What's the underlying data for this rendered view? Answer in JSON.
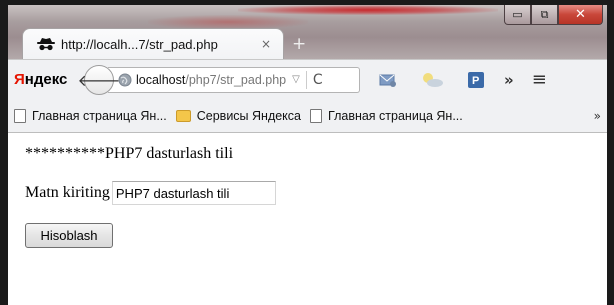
{
  "window": {
    "buttons": {
      "minimize": "▭",
      "maximize": "⧉",
      "close": "✕"
    }
  },
  "tab": {
    "title": "http://localh...7/str_pad.php",
    "close": "×",
    "new_tab": "+",
    "icon": "spy-incognito-icon"
  },
  "toolbar": {
    "logo": {
      "first": "Я",
      "rest": "ндекс"
    },
    "back_icon": "back-arrow-icon",
    "back_glyph": "🡐",
    "url": {
      "host": "localhost",
      "path": "/php7/str_pad.php"
    },
    "url_dropdown": "▽",
    "reload": "C",
    "overflow": "»",
    "menu": "≡"
  },
  "bookmarks": {
    "items": [
      {
        "label": "Главная страница Ян...",
        "icon": "page-icon"
      },
      {
        "label": "Сервисы Яндекса",
        "icon": "folder-icon"
      },
      {
        "label": "Главная страница Ян...",
        "icon": "page-icon"
      }
    ],
    "more": "»"
  },
  "page": {
    "output": "**********PHP7 dasturlash tili",
    "form": {
      "label": "Matn kiriting",
      "input_value": "PHP7 dasturlash tili",
      "submit_label": "Hisoblash"
    }
  }
}
